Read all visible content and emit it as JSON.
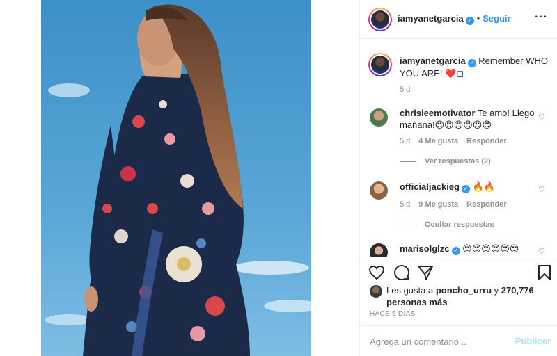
{
  "header": {
    "username": "iamyanetgarcia",
    "separator": "•",
    "follow_label": "Seguir",
    "more_icon": "more-horizontal-icon"
  },
  "caption": {
    "username": "iamyanetgarcia",
    "text": "Remember WHO YOU ARE! ❤️◻",
    "time": "5 d"
  },
  "comments": [
    {
      "username": "chrisleemotivator",
      "text": "Te amo! Llego mañana!😍😍😍😍😍😍",
      "time": "5 d",
      "likes": "4 Me gusta",
      "reply_label": "Responder",
      "replies_toggle": "Ver respuestas (2)"
    },
    {
      "username": "officialjackieg",
      "text": "🔥🔥",
      "time": "5 d",
      "likes": "9 Me gusta",
      "reply_label": "Responder",
      "replies_toggle": "Ocultar respuestas"
    },
    {
      "username": "marisolglzc",
      "text": "😍😍😍😍😍😍"
    }
  ],
  "likes": {
    "prefix": "Les gusta a",
    "user": "poncho_urru",
    "connector": "y",
    "count": "270,776 personas más"
  },
  "time_ago": "HACE 5 DÍAS",
  "comment_box": {
    "placeholder": "Agrega un comentario...",
    "post_label": "Publicar"
  },
  "colors": {
    "link": "#3897f0",
    "verified": "#3897f0",
    "muted": "#8e8e8e",
    "post_disabled": "#b2dffc"
  }
}
